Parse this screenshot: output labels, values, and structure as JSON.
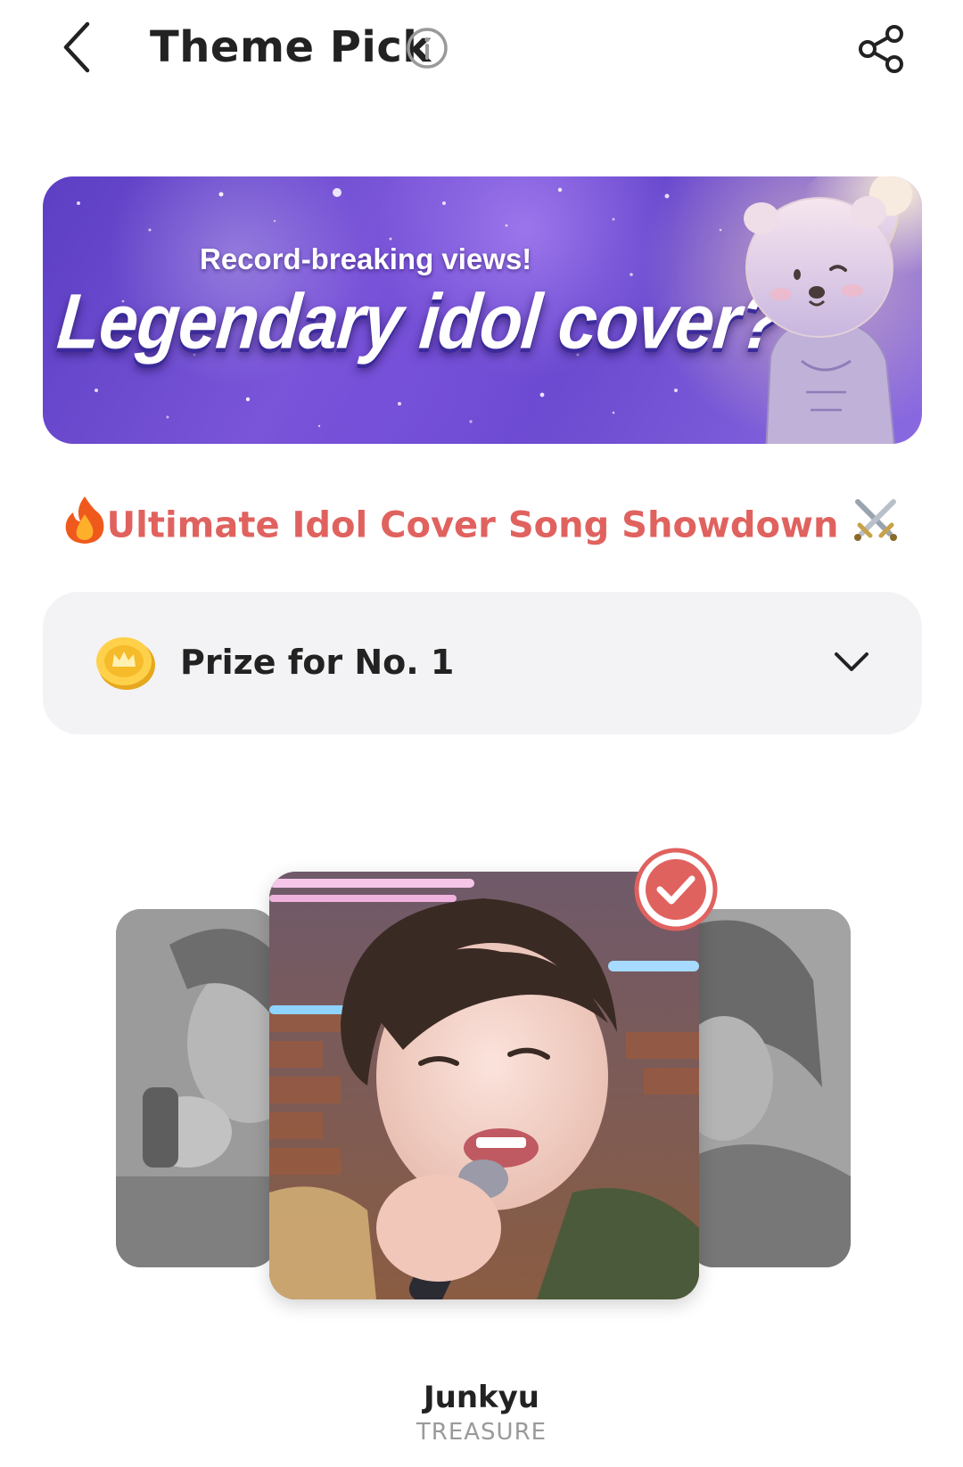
{
  "header": {
    "title": "Theme Pick",
    "back_icon": "chevron-left-icon",
    "info_icon": "info-icon",
    "share_icon": "share-icon"
  },
  "banner": {
    "subtitle": "Record-breaking views!",
    "title": "Legendary idol cover?",
    "mascot_icon": "bear-astronaut-mascot"
  },
  "theme": {
    "heading": "Ultimate Idol Cover Song Showdown",
    "leading_emoji": "🔥",
    "trailing_emoji": "⚔️"
  },
  "prize": {
    "label": "Prize for No. 1",
    "icon": "gold-crown-coin-icon",
    "expand_icon": "chevron-down-icon"
  },
  "candidate": {
    "name": "Junkyu",
    "group": "TREASURE",
    "selected": true
  },
  "colors": {
    "accent_red": "#e0625f",
    "banner_purple": "#6a49cf",
    "prize_bg": "#f3f3f5",
    "muted_text": "#9a9a9a"
  }
}
